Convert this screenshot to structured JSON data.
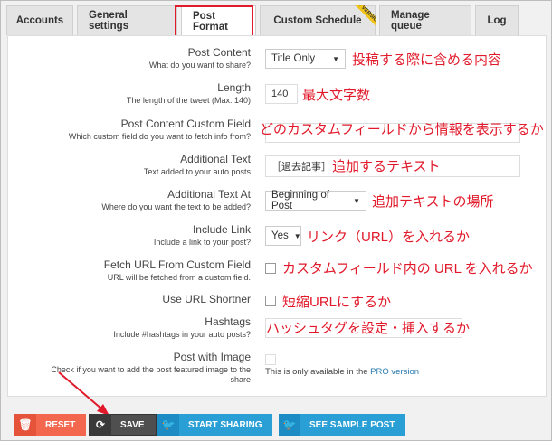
{
  "tabs": [
    {
      "label": "Accounts"
    },
    {
      "label": "General settings"
    },
    {
      "label": "Post Format"
    },
    {
      "label": "Custom Schedule",
      "badge": "PRO VERSION"
    },
    {
      "label": "Manage queue"
    },
    {
      "label": "Log"
    }
  ],
  "fields": {
    "post_content": {
      "label": "Post Content",
      "desc": "What do you want to share?",
      "value": "Title Only",
      "annotation": "投稿する際に含める内容"
    },
    "length": {
      "label": "Length",
      "desc": "The length of the tweet (Max: 140)",
      "value": "140",
      "annotation": "最大文字数"
    },
    "custom_field": {
      "label": "Post Content Custom Field",
      "desc": "Which custom field do you want to fetch info from?",
      "value": "",
      "annotation": "どのカスタムフィールドから情報を表示するか"
    },
    "additional_text": {
      "label": "Additional Text",
      "desc": "Text added to your auto posts",
      "value": "［過去記事］",
      "annotation": "追加するテキスト"
    },
    "additional_text_at": {
      "label": "Additional Text At",
      "desc": "Where do you want the text to be added?",
      "value": "Beginning of Post",
      "annotation": "追加テキストの場所"
    },
    "include_link": {
      "label": "Include Link",
      "desc": "Include a link to your post?",
      "value": "Yes",
      "annotation": "リンク（URL）を入れるか"
    },
    "fetch_url": {
      "label": "Fetch URL From Custom Field",
      "desc": "URL will be fetched from a custom field.",
      "annotation": "カスタムフィールド内の URL を入れるか"
    },
    "url_shortner": {
      "label": "Use URL Shortner",
      "annotation": "短縮URLにするか"
    },
    "hashtags": {
      "label": "Hashtags",
      "desc": "Include #hashtags in your auto posts?",
      "value": "",
      "annotation": "ハッシュタグを設定・挿入するか"
    },
    "post_with_image": {
      "label": "Post with Image",
      "desc_line1": "Check if you want to add the post featured image to the",
      "desc_line2": "share",
      "note_prefix": "This is only available in the ",
      "note_link": "PRO version"
    }
  },
  "buttons": {
    "reset": "RESET",
    "save": "SAVE",
    "start_sharing": "START SHARING",
    "see_sample": "SEE SAMPLE POST"
  },
  "colors": {
    "annotation_red": "#e1192a",
    "reset": "#f2674e",
    "save": "#4f4f4f",
    "twitter": "#2a9fd6"
  }
}
